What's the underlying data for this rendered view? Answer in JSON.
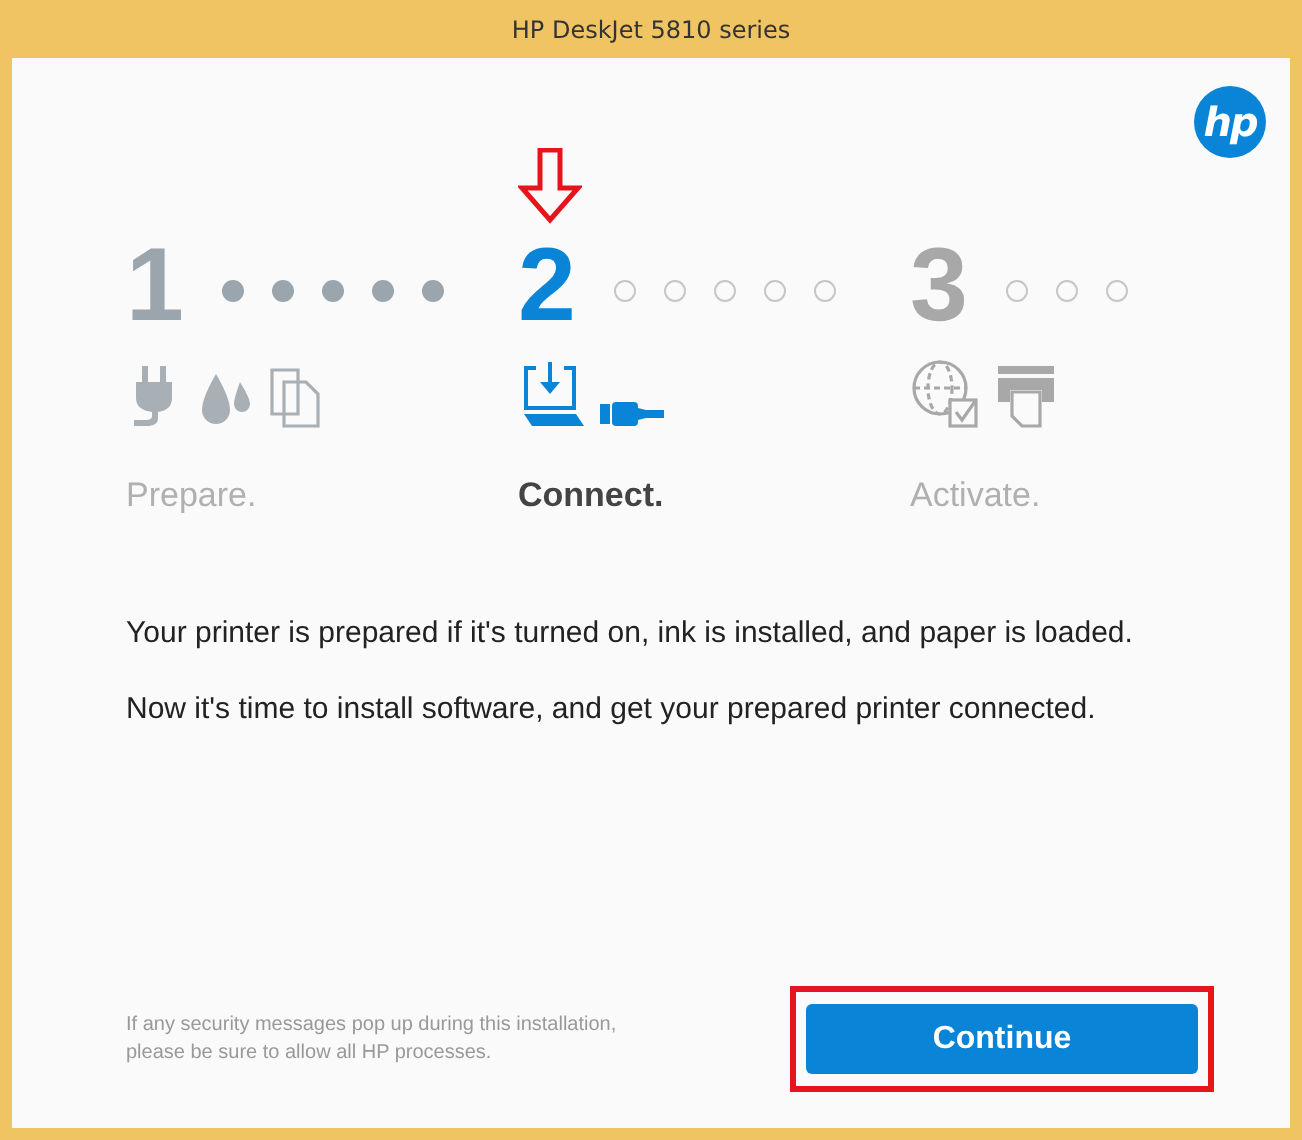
{
  "window": {
    "title": "HP DeskJet 5810 series"
  },
  "logo": "hp",
  "steps": [
    {
      "number": "1",
      "label": "Prepare.",
      "kind": "done",
      "arrow": false,
      "dots": [
        {
          "filled": true
        },
        {
          "filled": true
        },
        {
          "filled": true
        },
        {
          "filled": true
        },
        {
          "filled": true
        }
      ]
    },
    {
      "number": "2",
      "label": "Connect.",
      "kind": "current",
      "arrow": true,
      "dots": [
        {
          "filled": false
        },
        {
          "filled": false
        },
        {
          "filled": false
        },
        {
          "filled": false
        },
        {
          "filled": false
        }
      ]
    },
    {
      "number": "3",
      "label": "Activate.",
      "kind": "upcoming",
      "arrow": false,
      "dots": [
        {
          "filled": false
        },
        {
          "filled": false
        },
        {
          "filled": false
        }
      ]
    }
  ],
  "paragraphs": [
    "Your printer is prepared if it's turned on, ink is installed, and paper is loaded.",
    "Now it's time to install software, and get your prepared printer connected."
  ],
  "note": "If any security messages pop up during this installation, please be sure to allow all HP processes.",
  "button": {
    "label": "Continue",
    "highlighted": true
  }
}
